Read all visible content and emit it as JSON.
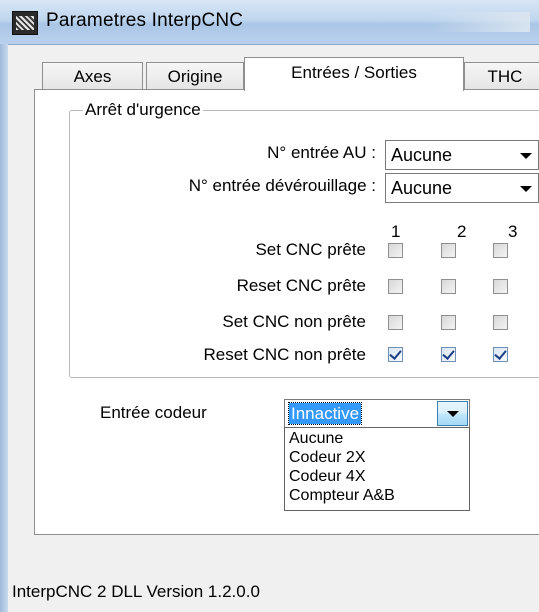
{
  "window": {
    "title": "Parametres InterpCNC"
  },
  "tabs": [
    {
      "label": "Axes"
    },
    {
      "label": "Origine"
    },
    {
      "label": "Entrées / Sorties"
    },
    {
      "label": "THC"
    }
  ],
  "active_tab": "Entrées / Sorties",
  "emergency": {
    "group_label": "Arrêt d'urgence",
    "au_input_label": "N° entrée AU :",
    "au_input_value": "Aucune",
    "unlock_input_label": "N° entrée dévérouillage :",
    "unlock_input_value": "Aucune"
  },
  "outputs": {
    "columns": [
      "1",
      "2",
      "3"
    ],
    "rows": [
      {
        "label": "Set CNC prête",
        "checked": [
          false,
          false,
          false
        ]
      },
      {
        "label": "Reset CNC prête",
        "checked": [
          false,
          false,
          false
        ]
      },
      {
        "label": "Set CNC non prête",
        "checked": [
          false,
          false,
          false
        ]
      },
      {
        "label": "Reset CNC non prête",
        "checked": [
          true,
          true,
          true
        ]
      }
    ]
  },
  "encoder": {
    "label": "Entrée codeur",
    "value": "Innactive",
    "options": [
      "Aucune",
      "Codeur 2X",
      "Codeur 4X",
      "Compteur A&B"
    ]
  },
  "status_bar": {
    "text": "InterpCNC 2 DLL Version 1.2.0.0"
  }
}
